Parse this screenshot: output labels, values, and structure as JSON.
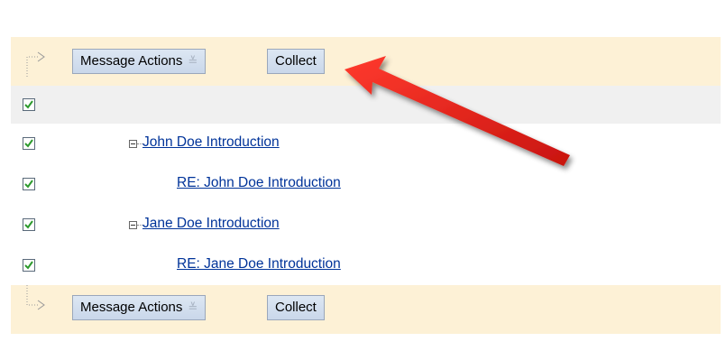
{
  "toolbar_top": {
    "message_actions_label": "Message Actions",
    "collect_label": "Collect"
  },
  "toolbar_bottom": {
    "message_actions_label": "Message Actions",
    "collect_label": "Collect"
  },
  "threads": [
    {
      "title": "John Doe Introduction",
      "level": 0,
      "checked": true
    },
    {
      "title": "RE: John Doe Introduction",
      "level": 1,
      "checked": true
    },
    {
      "title": "Jane Doe Introduction",
      "level": 0,
      "checked": true
    },
    {
      "title": "RE: Jane Doe Introduction",
      "level": 1,
      "checked": true
    }
  ],
  "select_all_checked": true,
  "colors": {
    "bar_bg": "#fdf1d6",
    "link": "#003399",
    "check": "#2d9a2d",
    "arrow": "#e8201b"
  }
}
